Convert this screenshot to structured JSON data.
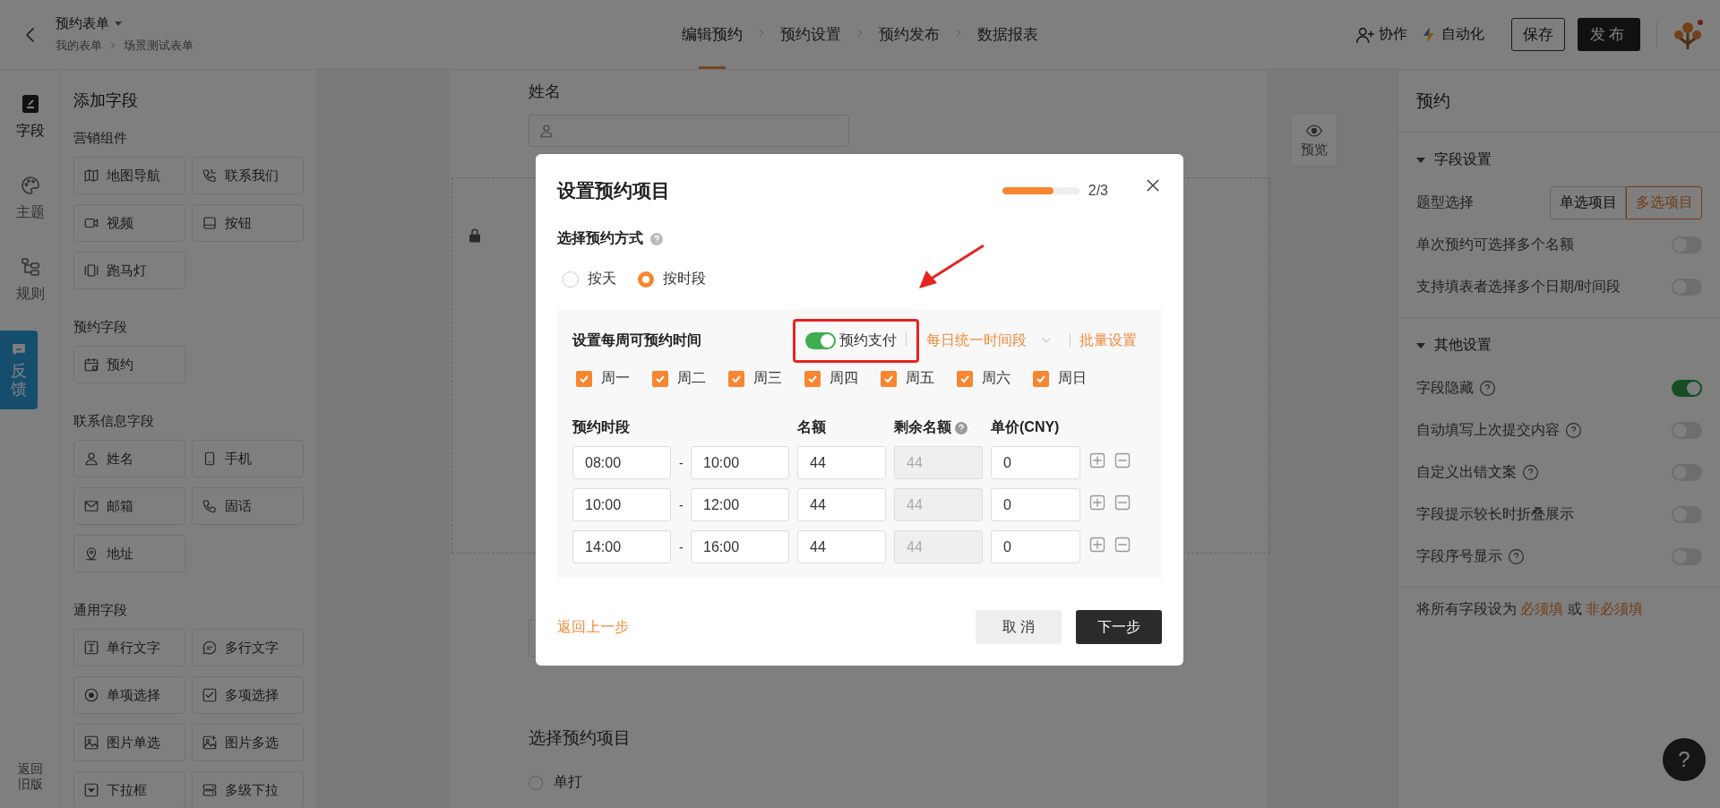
{
  "top_bar": {
    "title": "预约表单",
    "breadcrumbs": [
      "我的表单",
      "场景测试表单"
    ],
    "steps": [
      {
        "label": "编辑预约",
        "selected": true
      },
      {
        "label": "预约设置",
        "selected": false
      },
      {
        "label": "预约发布",
        "selected": false
      },
      {
        "label": "数据报表",
        "selected": false
      }
    ],
    "collaborate": "协作",
    "automation": "自动化",
    "save": "保存",
    "publish": "发布"
  },
  "rail": {
    "items": [
      {
        "label": "字段",
        "selected": true
      },
      {
        "label": "主题",
        "selected": false
      },
      {
        "label": "规则",
        "selected": false
      }
    ],
    "feedback": "反馈",
    "legacy": "返回旧版"
  },
  "field_panel": {
    "title": "添加字段",
    "groups": [
      {
        "title": "营销组件",
        "items": [
          "地图导航",
          "联系我们",
          "视频",
          "按钮",
          "跑马灯"
        ]
      },
      {
        "title": "预约字段",
        "items": [
          "预约"
        ]
      },
      {
        "title": "联系信息字段",
        "items": [
          "姓名",
          "手机",
          "邮箱",
          "固话",
          "地址"
        ]
      },
      {
        "title": "通用字段",
        "items": [
          "单行文字",
          "多行文字",
          "单项选择",
          "多项选择",
          "图片单选",
          "图片多选",
          "下拉框",
          "多级下拉"
        ]
      }
    ]
  },
  "form": {
    "preview": "预览",
    "name_label": "姓名",
    "section_title": "选择预约项目",
    "options": [
      {
        "label": "单打",
        "selected": false
      }
    ]
  },
  "settings": {
    "title": "预约",
    "sections": [
      {
        "title": "字段设置",
        "expanded": true,
        "rows": [
          {
            "kind": "segmented",
            "label": "题型选择",
            "options": [
              {
                "label": "单选项目",
                "selected": false
              },
              {
                "label": "多选项目",
                "selected": true
              }
            ]
          },
          {
            "kind": "switch",
            "label": "单次预约可选择多个名额",
            "on": false,
            "help": false
          },
          {
            "kind": "switch",
            "label": "支持填表者选择多个日期/时间段",
            "on": false,
            "help": false
          }
        ]
      },
      {
        "title": "其他设置",
        "expanded": true,
        "rows": [
          {
            "kind": "switch",
            "label": "字段隐藏",
            "on": true,
            "help": true
          },
          {
            "kind": "switch",
            "label": "自动填写上次提交内容",
            "on": false,
            "help": true
          },
          {
            "kind": "switch",
            "label": "自定义出错文案",
            "on": false,
            "help": true
          },
          {
            "kind": "switch",
            "label": "字段提示较长时折叠展示",
            "on": false,
            "help": false
          },
          {
            "kind": "switch",
            "label": "字段序号显示",
            "on": false,
            "help": true
          }
        ]
      }
    ],
    "footer": {
      "prefix": "将所有字段设为",
      "required": "必须填",
      "or": "或",
      "optional": "非必须填"
    }
  },
  "modal": {
    "title": "设置预约项目",
    "progress": {
      "level": 0.67,
      "reading": "2/3"
    },
    "method": {
      "label": "选择预约方式",
      "options": [
        {
          "label": "按天",
          "selected": false
        },
        {
          "label": "按时段",
          "selected": true
        }
      ]
    },
    "weekly": {
      "title": "设置每周可预约时间",
      "payment": {
        "label": "预约支付",
        "on": true
      },
      "uniform": "每日统一时间段",
      "batch": "批量设置",
      "days": [
        {
          "label": "周一",
          "checked": true
        },
        {
          "label": "周二",
          "checked": true
        },
        {
          "label": "周三",
          "checked": true
        },
        {
          "label": "周四",
          "checked": true
        },
        {
          "label": "周五",
          "checked": true
        },
        {
          "label": "周六",
          "checked": true
        },
        {
          "label": "周日",
          "checked": true
        }
      ]
    },
    "slots": {
      "columns": [
        "预约时段",
        "名额",
        "剩余名额",
        "单价(CNY)"
      ],
      "rows": [
        {
          "start": "08:00",
          "separator": "-",
          "end": "10:00",
          "quota": "44",
          "remaining": "44",
          "price": "0"
        },
        {
          "start": "10:00",
          "separator": "-",
          "end": "12:00",
          "quota": "44",
          "remaining": "44",
          "price": "0"
        },
        {
          "start": "14:00",
          "separator": "-",
          "end": "16:00",
          "quota": "44",
          "remaining": "44",
          "price": "0"
        }
      ]
    },
    "back": "返回上一步",
    "cancel": "取 消",
    "next": "下一步"
  },
  "help_button": "?"
}
